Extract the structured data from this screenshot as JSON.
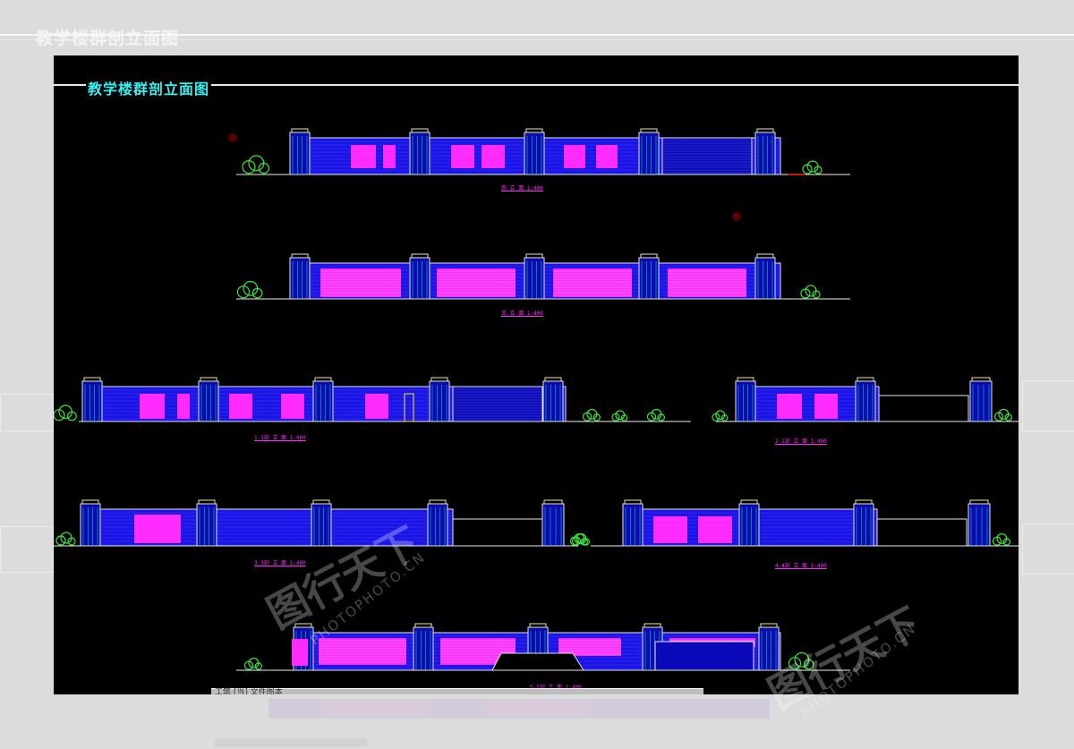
{
  "sheet": {
    "title": "教学楼群剖立面图"
  },
  "captions": [
    "南 立 面 1:400",
    "北 立 面 1:400",
    "1-1剖 立 面 1:400",
    "2-2剖 立 面 1:400",
    "3-3剖 立 面 1:400",
    "4-4剖 立 面 1:400",
    "5-5剖 立 面 1:400"
  ],
  "command_strip": {
    "text": "工筑 [当]  文件图本"
  },
  "watermark": {
    "brand": "图行天下",
    "url": "PHOTOPHOTO.CN"
  },
  "colors": {
    "canvas": "#000000",
    "building": "#1a14e6",
    "accent": "#ff2bff",
    "plant": "#39e639",
    "outline": "#e6e6e6",
    "title": "#35f1f1"
  }
}
